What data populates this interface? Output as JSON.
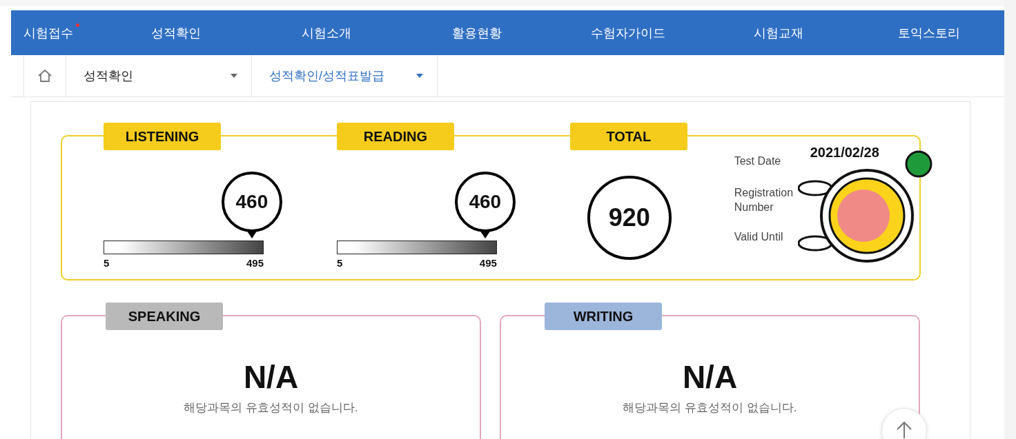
{
  "nav": {
    "items": [
      {
        "label": "시험접수",
        "marked": true
      },
      {
        "label": "성적확인",
        "marked": false
      },
      {
        "label": "시험소개",
        "marked": false
      },
      {
        "label": "활용현황",
        "marked": false
      },
      {
        "label": "수험자가이드",
        "marked": false
      },
      {
        "label": "시험교재",
        "marked": false
      },
      {
        "label": "토익스토리",
        "marked": false
      }
    ]
  },
  "breadcrumb": [
    {
      "label": "성적확인",
      "selected": false
    },
    {
      "label": "성적확인/성적표발급",
      "selected": true
    }
  ],
  "scores": [
    {
      "kind": "bar",
      "title": "LISTENING",
      "score": "460",
      "level": 0.93,
      "min": "5",
      "max": "495"
    },
    {
      "kind": "bar",
      "title": "READING",
      "score": "460",
      "level": 0.93,
      "min": "5",
      "max": "495"
    },
    {
      "kind": "total",
      "title": "TOTAL",
      "score": "920"
    }
  ],
  "info": [
    {
      "label": "Test Date",
      "value": "2021/02/28"
    },
    {
      "label": "Registration Number"
    },
    {
      "label": "Valid Until"
    }
  ],
  "sections": [
    {
      "title": "SPEAKING",
      "color": "#b9b9b9",
      "score": "N/A",
      "note": "해당과목의 유효성적이 없습니다."
    },
    {
      "title": "WRITING",
      "color": "#9cb5da",
      "score": "N/A",
      "note": "해당과목의 유효성적이 없습니다."
    }
  ]
}
